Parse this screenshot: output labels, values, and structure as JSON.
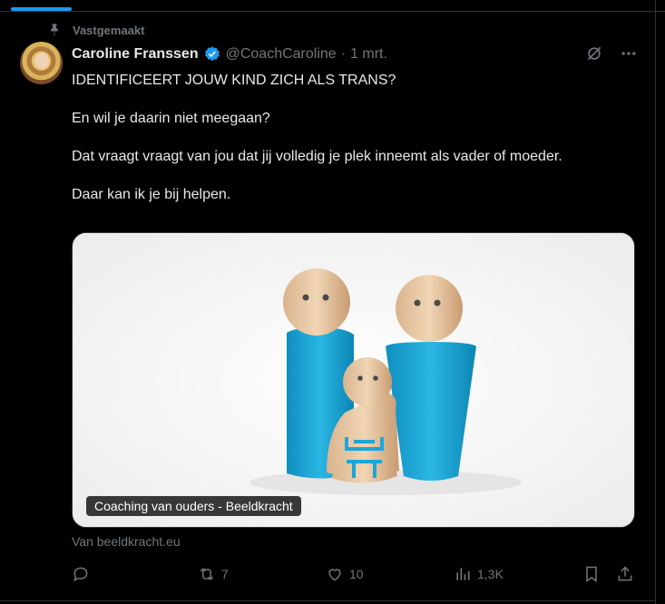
{
  "pinned": {
    "label": "Vastgemaakt"
  },
  "author": {
    "name": "Caroline Franssen",
    "handle": "@CoachCaroline",
    "separator": "·",
    "date": "1 mrt."
  },
  "tweet": {
    "paragraphs": [
      "IDENTIFICEERT JOUW KIND ZICH ALS TRANS?",
      "En wil je daarin niet meegaan?",
      "Dat vraagt vraagt van jou dat jij volledig je plek inneemt als vader of moeder.",
      "Daar kan ik je bij helpen."
    ]
  },
  "media": {
    "caption": "Coaching van ouders - Beeldkracht",
    "source": "Van beeldkracht.eu"
  },
  "actions": {
    "reply": {
      "icon": "reply-icon",
      "count": ""
    },
    "repost": {
      "icon": "repost-icon",
      "count": "7"
    },
    "like": {
      "icon": "heart-icon",
      "count": "10"
    },
    "views": {
      "icon": "views-icon",
      "count": "1,3K"
    },
    "bookmark": {
      "icon": "bookmark-icon"
    },
    "share": {
      "icon": "share-icon"
    }
  },
  "colors": {
    "background": "#000000",
    "text": "#e7e9ea",
    "muted": "#71767b",
    "accent": "#1d9bf0",
    "figure_blue": "#1aa7d8",
    "wood": "#e8c9a6"
  }
}
